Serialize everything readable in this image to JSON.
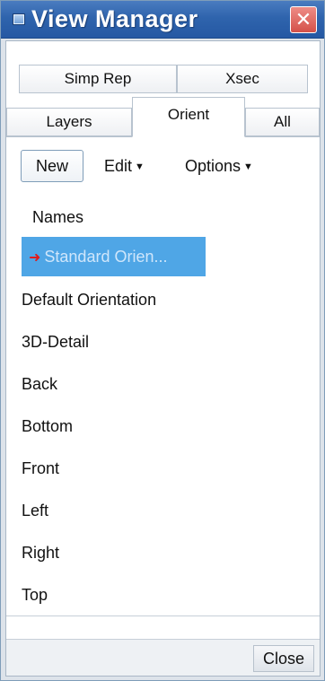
{
  "window": {
    "title": "View Manager",
    "close_glyph": "✕"
  },
  "tabs": {
    "row1": [
      {
        "label": "Simp Rep",
        "active": false
      },
      {
        "label": "Xsec",
        "active": false
      }
    ],
    "row2": [
      {
        "label": "Layers",
        "active": false
      },
      {
        "label": "Orient",
        "active": true
      },
      {
        "label": "All",
        "active": false
      }
    ]
  },
  "toolbar": {
    "new_label": "New",
    "edit_label": "Edit",
    "options_label": "Options",
    "caret_glyph": "▼"
  },
  "list": {
    "header": "Names",
    "selected_arrow": "➜",
    "items": [
      {
        "label": "Standard Orien...",
        "selected": true
      },
      {
        "label": "Default Orientation",
        "selected": false
      },
      {
        "label": "3D-Detail",
        "selected": false
      },
      {
        "label": "Back",
        "selected": false
      },
      {
        "label": "Bottom",
        "selected": false
      },
      {
        "label": "Front",
        "selected": false
      },
      {
        "label": "Left",
        "selected": false
      },
      {
        "label": "Right",
        "selected": false
      },
      {
        "label": "Top",
        "selected": false
      }
    ]
  },
  "footer": {
    "close_label": "Close"
  },
  "colors": {
    "titlebar": "#2f64ad",
    "selection": "#4fa6e6",
    "arrow": "#e01b1b",
    "close_button": "#d45149"
  }
}
